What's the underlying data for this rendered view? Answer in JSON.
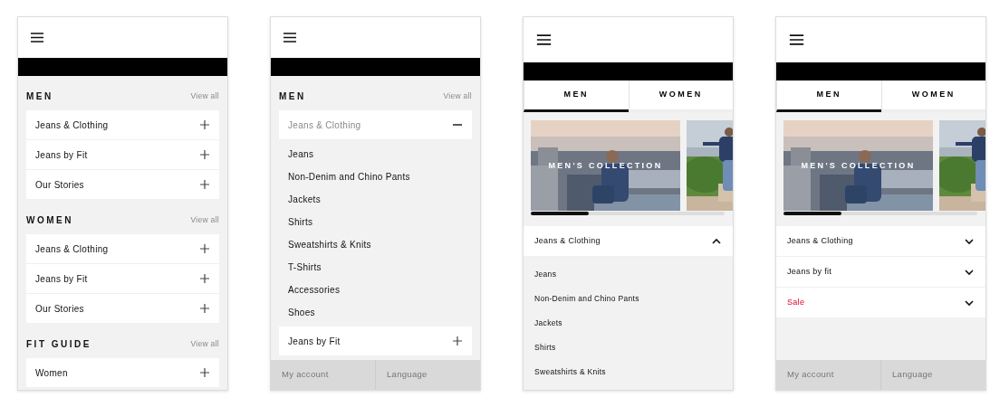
{
  "screens": [
    {
      "kind": "sections",
      "sections": [
        {
          "title": "MEN",
          "view_all": "View all",
          "items": [
            {
              "label": "Jeans & Clothing",
              "expanded": false
            },
            {
              "label": "Jeans by Fit",
              "expanded": false
            },
            {
              "label": "Our Stories",
              "expanded": false
            }
          ]
        },
        {
          "title": "WOMEN",
          "view_all": "View all",
          "items": [
            {
              "label": "Jeans & Clothing",
              "expanded": false
            },
            {
              "label": "Jeans by Fit",
              "expanded": false
            },
            {
              "label": "Our Stories",
              "expanded": false
            }
          ]
        },
        {
          "title": "FIT GUIDE",
          "view_all": "View all",
          "items": [
            {
              "label": "Women",
              "expanded": false
            }
          ]
        }
      ]
    },
    {
      "kind": "sections",
      "sections": [
        {
          "title": "MEN",
          "view_all": "View all",
          "items": [
            {
              "label": "Jeans & Clothing",
              "expanded": true,
              "children": [
                {
                  "label": "Jeans"
                },
                {
                  "label": "Non-Denim and Chino Pants"
                },
                {
                  "label": "Jackets"
                },
                {
                  "label": "Shirts"
                },
                {
                  "label": "Sweatshirts & Knits"
                },
                {
                  "label": "T-Shirts"
                },
                {
                  "label": "Accessories"
                },
                {
                  "label": "Shoes"
                }
              ]
            },
            {
              "label": "Jeans by Fit",
              "expanded": false
            }
          ]
        }
      ],
      "footer": [
        "My account",
        "Language"
      ]
    },
    {
      "kind": "tabs",
      "tabs": [
        {
          "label": "MEN",
          "selected": true
        },
        {
          "label": "WOMEN",
          "selected": false
        }
      ],
      "carousel": {
        "slides": [
          {
            "kind": "picture",
            "caption": "MEN'S COLLECTION"
          },
          {
            "kind": "picture"
          }
        ],
        "level": 0.3
      },
      "items": [
        {
          "label": "Jeans & Clothing",
          "expanded": true,
          "highlighted": false,
          "children": [
            {
              "label": "Jeans"
            },
            {
              "label": "Non-Denim and Chino Pants"
            },
            {
              "label": "Jackets"
            },
            {
              "label": "Shirts"
            },
            {
              "label": "Sweatshirts & Knits"
            }
          ]
        }
      ]
    },
    {
      "kind": "tabs",
      "tabs": [
        {
          "label": "MEN",
          "selected": true
        },
        {
          "label": "WOMEN",
          "selected": false
        }
      ],
      "carousel": {
        "slides": [
          {
            "kind": "picture",
            "caption": "MEN'S COLLECTION"
          },
          {
            "kind": "picture"
          }
        ],
        "level": 0.3
      },
      "items": [
        {
          "label": "Jeans & Clothing",
          "expanded": false,
          "highlighted": false
        },
        {
          "label": "Jeans by fit",
          "expanded": false,
          "highlighted": false
        },
        {
          "label": "Sale",
          "expanded": false,
          "highlighted": true
        }
      ],
      "footer": [
        "My account",
        "Language"
      ]
    }
  ]
}
